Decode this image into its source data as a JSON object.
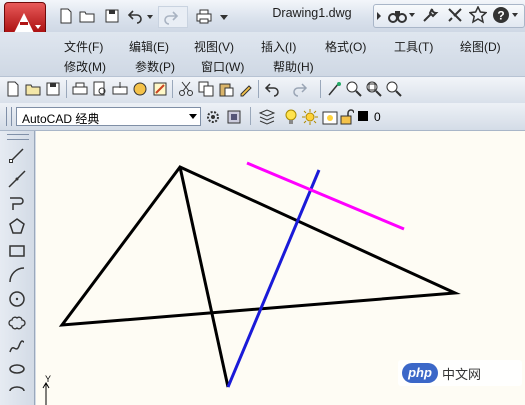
{
  "window": {
    "document_title": "Drawing1.dwg"
  },
  "menu": {
    "row1": [
      "文件(F)",
      "编辑(E)",
      "视图(V)",
      "插入(I)",
      "格式(O)",
      "工具(T)",
      "绘图(D)"
    ],
    "row2": [
      "修改(M)",
      "参数(P)",
      "窗口(W)",
      "帮助(H)"
    ]
  },
  "workspace": {
    "selected": "AutoCAD 经典"
  },
  "layer": {
    "name": "0",
    "color": "#000000"
  },
  "canvas": {
    "background": "#fefcf4",
    "ucs_axis_label": "Y",
    "line_colors": {
      "triangle": "#000000",
      "blue_line": "#1a1ad8",
      "magenta_line": "#ff00ff"
    }
  },
  "watermark": {
    "logo_text": "php",
    "site_text": "中文网"
  },
  "colors": {
    "app_button": "#b01515",
    "toolbar_bg": "#dfe6ef"
  }
}
